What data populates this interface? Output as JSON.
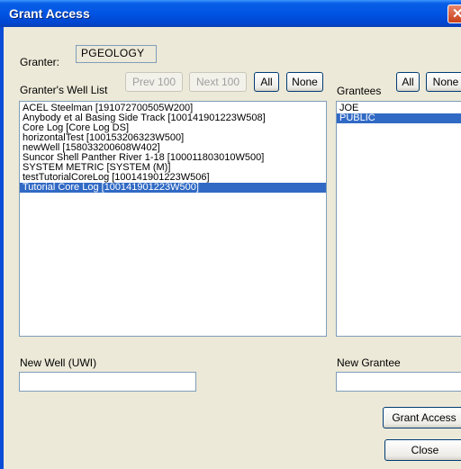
{
  "window": {
    "title": "Grant Access"
  },
  "granter": {
    "label": "Granter:",
    "value": "PGEOLOGY"
  },
  "wells": {
    "label": "Granter's Well List",
    "prev_label": "Prev 100",
    "next_label": "Next 100",
    "all_label": "All",
    "none_label": "None",
    "items": [
      "ACEL Steelman [191072700505W200]",
      "Anybody et al Basing Side Track [100141901223W508]",
      "Core Log [Core Log DS]",
      "horizontalTest [100153206323W500]",
      "newWell [158033200608W402]",
      "Suncor Shell Panther River 1-18 [100011803010W500]",
      "SYSTEM METRIC [SYSTEM (M)]",
      "testTutorialCoreLog [100141901223W506]",
      "Tutorial Core Log [100141901223W500]"
    ]
  },
  "grantees": {
    "label": "Grantees",
    "all_label": "All",
    "none_label": "None",
    "items": [
      "JOE",
      "PUBLIC"
    ]
  },
  "new_well": {
    "label": "New Well (UWI)",
    "value": ""
  },
  "new_grantee": {
    "label": "New Grantee",
    "value": ""
  },
  "actions": {
    "grant_label": "Grant Access",
    "close_label": "Close"
  }
}
